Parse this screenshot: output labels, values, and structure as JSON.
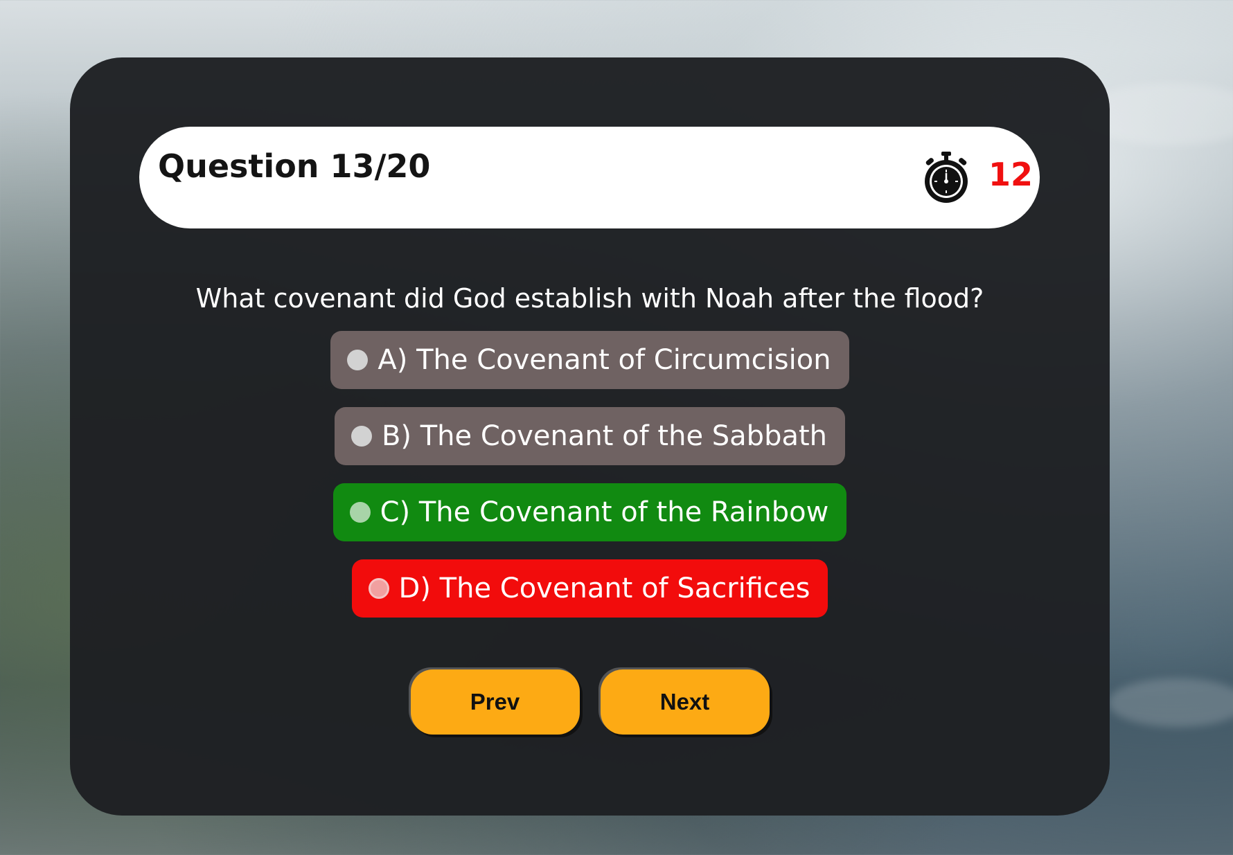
{
  "header": {
    "question_counter": "Question 13/20",
    "timer_value": "12"
  },
  "question": {
    "text": "What covenant did God establish with Noah after the flood?"
  },
  "options": [
    {
      "label": "A) The Covenant of Circumcision",
      "state": "neutral"
    },
    {
      "label": "B) The Covenant of the Sabbath",
      "state": "neutral"
    },
    {
      "label": "C) The Covenant of the Rainbow",
      "state": "correct"
    },
    {
      "label": "D) The Covenant of Sacrifices",
      "state": "wrong"
    }
  ],
  "navigation": {
    "prev_label": "Prev",
    "next_label": "Next"
  },
  "colors": {
    "card_background": "#1e2023",
    "neutral_option": "#6f6262",
    "correct_option": "#118a11",
    "wrong_option": "#f20c0c",
    "nav_button": "#fdaa14",
    "timer_text": "#f01010"
  },
  "icons": {
    "timer": "stopwatch-icon"
  }
}
